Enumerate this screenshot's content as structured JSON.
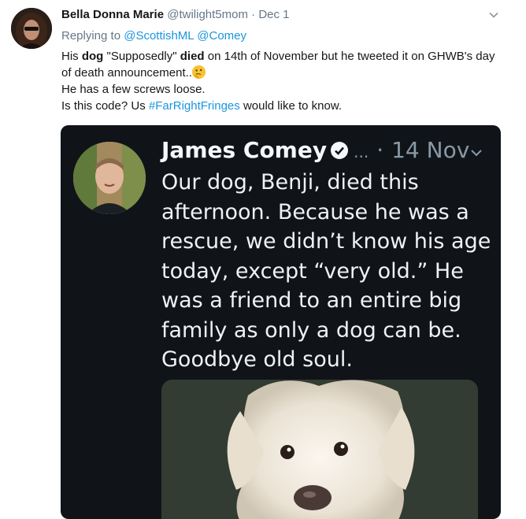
{
  "tweet": {
    "display_name": "Bella Donna Marie",
    "handle": "@twilight5mom",
    "separator": "·",
    "date": "Dec 1",
    "reply_prefix": "Replying to",
    "reply_mentions": [
      "@ScottishML",
      "@Comey"
    ],
    "body": {
      "line1_a": "His ",
      "line1_dog": "dog",
      "line1_b": " \"Supposedly\" ",
      "line1_died": "died",
      "line1_c": " on 14th of November but he tweeted it on GHWB's day of death announcement..",
      "line2": "He has a few screws loose.",
      "line3_a": "Is this code? Us ",
      "line3_hashtag": "#FarRightFringes",
      "line3_b": "  would like to know."
    },
    "emoji": "thinking-face"
  },
  "embedded": {
    "display_name": "James Comey",
    "ellipsis": "...",
    "separator": "·",
    "date": "14 Nov",
    "text": "Our dog, Benji, died this afternoon.  Because he was a rescue, we didn’t know his age today, except “very old.”  He was a friend to an entire big family as only a dog can be. Goodbye old soul.",
    "verified_icon": "verified-badge-icon",
    "photo": "white-dog-photo"
  },
  "colors": {
    "link": "#1b95e0",
    "muted": "#657786",
    "embed_bg": "#101419",
    "embed_text": "#eef2f5"
  }
}
